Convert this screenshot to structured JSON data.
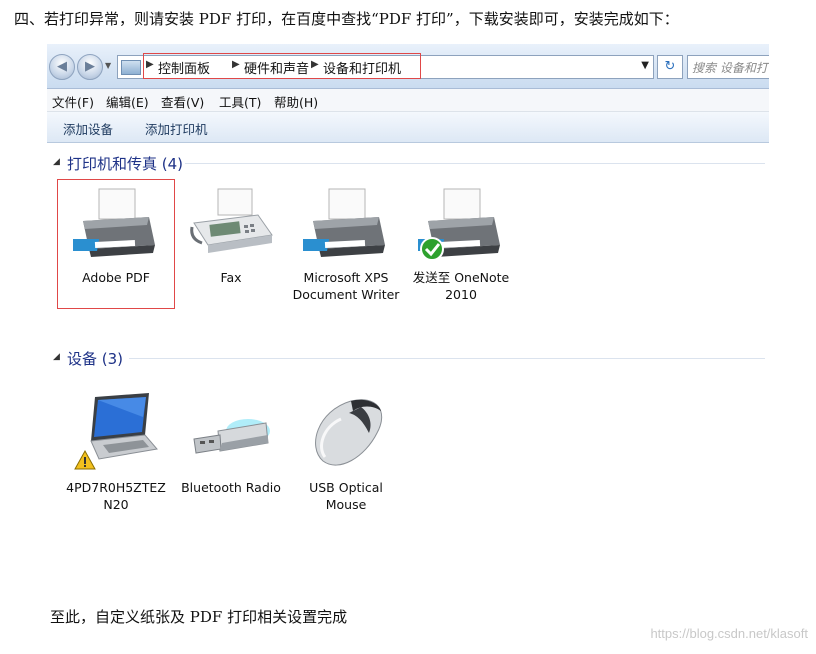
{
  "doc": {
    "intro": "四、若打印异常，则请安装 PDF 打印，在百度中查找“PDF 打印”，下载安装即可，安装完成如下：",
    "outro": "至此，自定义纸张及 PDF 打印相关设置完成",
    "watermark": "https://blog.csdn.net/klasoft"
  },
  "window": {
    "breadcrumbs": [
      "控制面板",
      "硬件和声音",
      "设备和打印机"
    ],
    "search_placeholder": "搜索 设备和打印机",
    "menu": [
      "文件(F)",
      "编辑(E)",
      "查看(V)",
      "工具(T)",
      "帮助(H)"
    ],
    "commands": [
      "添加设备",
      "添加打印机"
    ]
  },
  "groups": {
    "printers": {
      "title": "打印机和传真 (4)",
      "items": [
        {
          "label": "Adobe PDF",
          "icon": "printer-icon",
          "selected": true
        },
        {
          "label": "Fax",
          "icon": "fax-icon"
        },
        {
          "label": "Microsoft XPS Document Writer",
          "icon": "printer-icon"
        },
        {
          "label": "发送至 OneNote 2010",
          "icon": "printer-icon",
          "default": true
        }
      ]
    },
    "devices": {
      "title": "设备 (3)",
      "items": [
        {
          "label": "4PD7R0H5ZTEZ N20",
          "icon": "laptop-icon",
          "warning": true
        },
        {
          "label": "Bluetooth Radio",
          "icon": "usb-bluetooth-icon"
        },
        {
          "label": "USB Optical Mouse",
          "icon": "mouse-icon"
        }
      ]
    }
  },
  "colors": {
    "highlight_border": "#e04848",
    "group_title": "#1e3287",
    "default_check": "#2ea12e",
    "warning": "#f2c01e"
  }
}
